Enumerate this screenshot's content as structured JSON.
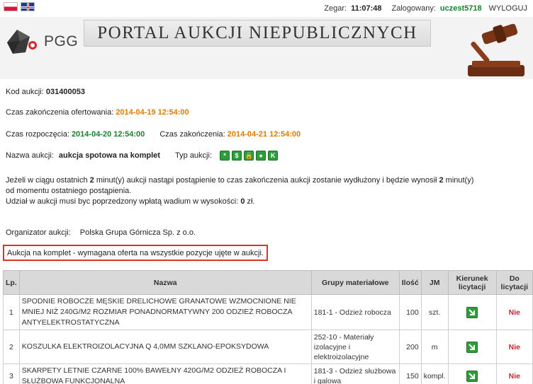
{
  "header": {
    "clock_label": "Zegar:",
    "clock_value": "11:07:48",
    "user_label": "Zalogowany:",
    "user_name": "uczest5718",
    "logout_label": "WYLOGUJ",
    "logo_text": "PGG",
    "portal_title": "PORTAL AUKCJI NIEPUBLICZNYCH"
  },
  "auction": {
    "code_label": "Kod aukcji:",
    "code_value": "031400053",
    "offer_end_label": "Czas zakończenia ofertowania:",
    "offer_end_value": "2014-04-19 12:54:00",
    "start_label": "Czas rozpoczęcia:",
    "start_value": "2014-04-20 12:54:00",
    "end_label": "Czas zakończenia:",
    "end_value": "2014-04-21 12:54:00",
    "name_label": "Nazwa aukcji:",
    "name_value": "aukcja spotowa na komplet",
    "type_label": "Typ aukcji:",
    "type_icons": [
      "*",
      "$",
      "🔒",
      "●",
      "K"
    ],
    "extension_p1": "Jeżeli w ciągu ostatnich",
    "extension_minutes1": "2",
    "extension_p2": "minut(y) aukcji nastąpi postąpienie to czas zakończenia aukcji zostanie wydłużony i będzie wynosił",
    "extension_minutes2": "2",
    "extension_p3": "minut(y)",
    "extension_line2": "od momentu ostatniego postąpienia.",
    "deposit_text": "Udział w aukcji musi byc poprzedzony wpłatą wadium w wysokości:",
    "deposit_value": "0",
    "deposit_unit": "zł.",
    "organizer_label": "Organizator aukcji:",
    "organizer_value": "Polska Grupa Górnicza Sp. z o.o.",
    "notice": "Aukcja na komplet - wymagana oferta na wszystkie pozycje ujęte w aukcji."
  },
  "table": {
    "headers": {
      "lp": "Lp.",
      "nazwa": "Nazwa",
      "grupa": "Grupy materiałowe",
      "ilosc": "Ilość",
      "jm": "JM",
      "kierunek": "Kierunek licytacji",
      "do": "Do licytacji"
    },
    "rows": [
      {
        "lp": "1",
        "nazwa": "SPODNIE ROBOCZE MĘSKIE DRELICHOWE GRANATOWE WZMOCNIONE NIE MNIEJ NIŻ 240G/M2 ROZMIAR PONADNORMATYWNY 200 ODZIEŻ ROBOCZA ANTYELEKTROSTATYCZNA",
        "grupa": "181-1 - Odzież robocza",
        "ilosc": "100",
        "jm": "szt.",
        "do": "Nie"
      },
      {
        "lp": "2",
        "nazwa": "KOSZULKA ELEKTROIZOLACYJNA Q 4,0MM SZKLANO-EPOKSYDOWA",
        "grupa": "252-10 - Materiały izolacyjne i elektroizolacyjne",
        "ilosc": "200",
        "jm": "m",
        "do": "Nie"
      },
      {
        "lp": "3",
        "nazwa": "SKARPETY LETNIE CZARNE 100% BAWEŁNY 420G/M2 ODZIEŻ ROBOCZA I SŁUŻBOWA FUNKCJONALNA",
        "grupa": "181-3 - Odzież służbowa i galowa",
        "ilosc": "150",
        "jm": "kompl.",
        "do": "Nie"
      }
    ]
  },
  "colors": {
    "accent_orange": "#e07b00",
    "accent_green": "#1a7f2e",
    "notice_border": "#d9342b",
    "no_red": "#c1272d"
  }
}
